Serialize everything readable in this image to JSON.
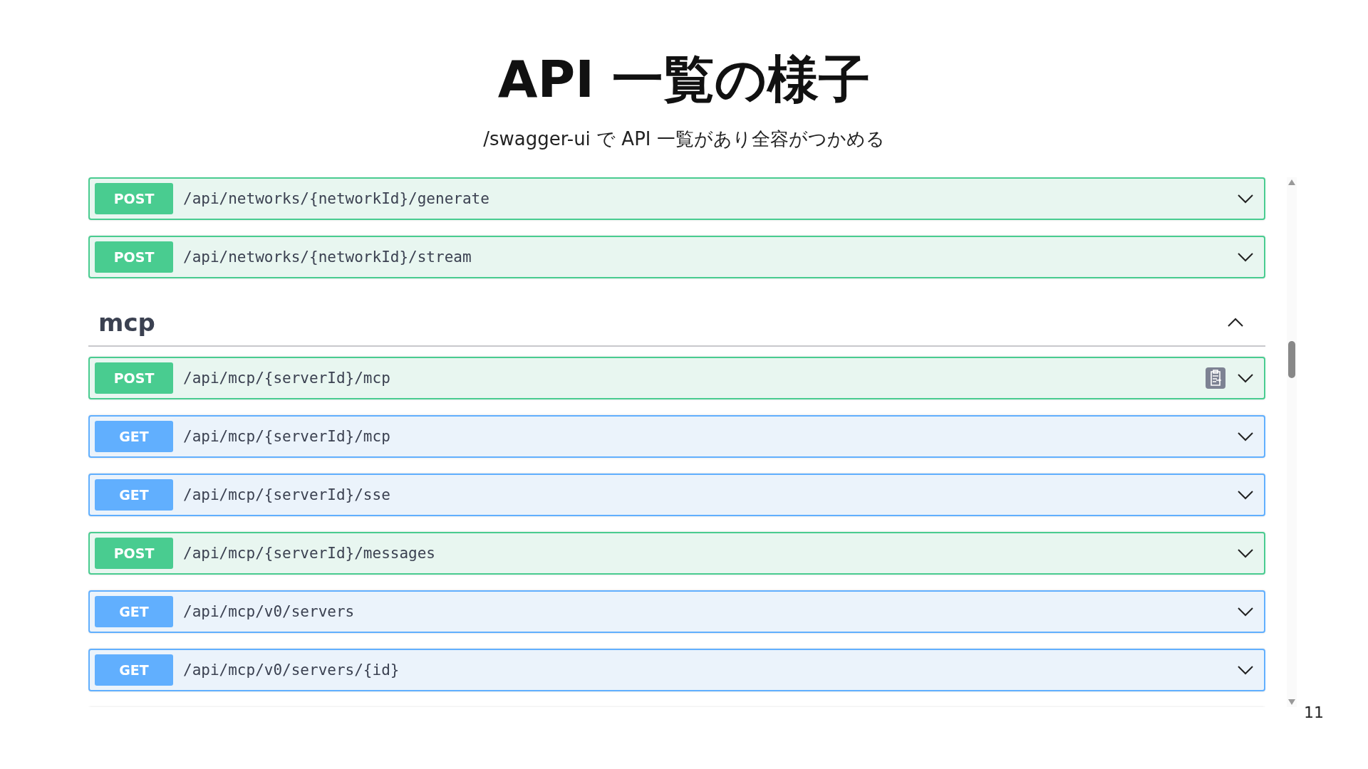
{
  "slide": {
    "title": "API 一覧の様子",
    "subtitle": "/swagger-ui で API 一覧があり全容がつかめる",
    "page_number": "11"
  },
  "groups": [
    {
      "endpoints": [
        {
          "method": "POST",
          "path": "/api/networks/{networkId}/generate",
          "copy_icon": false
        },
        {
          "method": "POST",
          "path": "/api/networks/{networkId}/stream",
          "copy_icon": false
        }
      ]
    },
    {
      "name": "mcp",
      "expanded": true,
      "endpoints": [
        {
          "method": "POST",
          "path": "/api/mcp/{serverId}/mcp",
          "copy_icon": true
        },
        {
          "method": "GET",
          "path": "/api/mcp/{serverId}/mcp",
          "copy_icon": false
        },
        {
          "method": "GET",
          "path": "/api/mcp/{serverId}/sse",
          "copy_icon": false
        },
        {
          "method": "POST",
          "path": "/api/mcp/{serverId}/messages",
          "copy_icon": false
        },
        {
          "method": "GET",
          "path": "/api/mcp/v0/servers",
          "copy_icon": false
        },
        {
          "method": "GET",
          "path": "/api/mcp/v0/servers/{id}",
          "copy_icon": false
        }
      ]
    }
  ]
}
